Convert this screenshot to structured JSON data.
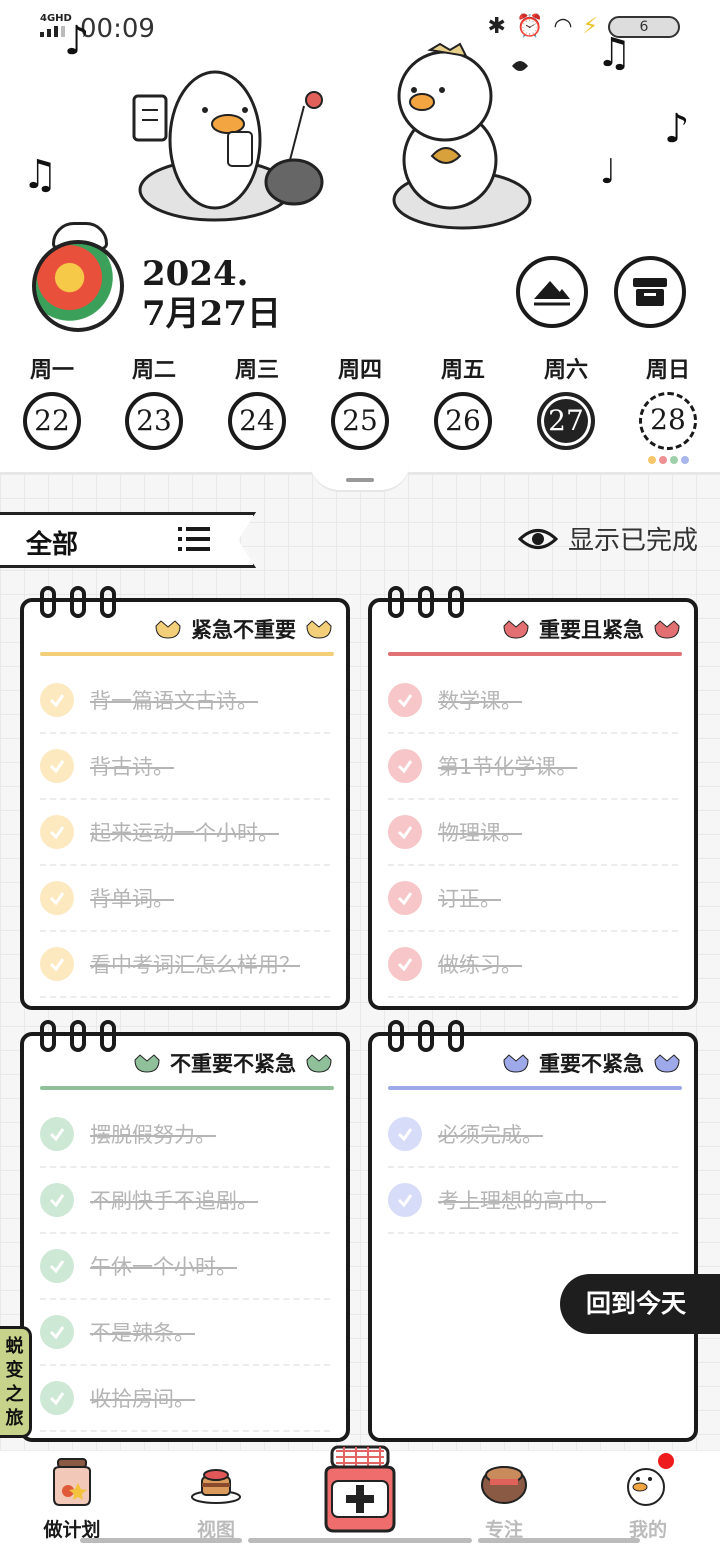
{
  "status_bar": {
    "network": "4GHD",
    "time": "00:09",
    "battery": "6"
  },
  "header": {
    "date_year": "2024.",
    "date_day": "7月27日"
  },
  "week": [
    {
      "label": "周一",
      "num": "22",
      "state": "normal"
    },
    {
      "label": "周二",
      "num": "23",
      "state": "normal"
    },
    {
      "label": "周三",
      "num": "24",
      "state": "normal"
    },
    {
      "label": "周四",
      "num": "25",
      "state": "normal"
    },
    {
      "label": "周五",
      "num": "26",
      "state": "normal"
    },
    {
      "label": "周六",
      "num": "27",
      "state": "active"
    },
    {
      "label": "周日",
      "num": "28",
      "state": "dashed"
    }
  ],
  "dot_colors": [
    "#f5c76a",
    "#ee8f93",
    "#9fd0a9",
    "#a9b6ee"
  ],
  "filter": {
    "label": "全部",
    "show_completed": "显示已完成"
  },
  "quadrants": [
    {
      "title": "紧急不重要",
      "accent": "#f3cf7a",
      "check_bg": "#fde9bf",
      "tasks": [
        "背一篇语文古诗。",
        "背古诗。",
        "起来运动一个小时。",
        "背单词。",
        "看中考词汇怎么样用？"
      ]
    },
    {
      "title": "重要且紧急",
      "accent": "#e26f72",
      "check_bg": "#f6c6c8",
      "tasks": [
        "数学课。",
        "第1节化学课。",
        "物理课。",
        "订正。",
        "做练习。"
      ]
    },
    {
      "title": "不重要不紧急",
      "accent": "#8fc09a",
      "check_bg": "#cde8d4",
      "tasks": [
        "摆脱假努力。",
        "不刷快手不追剧。",
        "午休一个小时。",
        "不是辣条。",
        "收拾房间。"
      ]
    },
    {
      "title": "重要不紧急",
      "accent": "#9ea9ea",
      "check_bg": "#d7dcf8",
      "tasks": [
        "必须完成。",
        "考上理想的高中。"
      ]
    }
  ],
  "side_tab": "蜕变之旅",
  "back_today": "回到今天",
  "nav": {
    "plan": "做计划",
    "view": "视图",
    "focus": "专注",
    "mine": "我的"
  }
}
